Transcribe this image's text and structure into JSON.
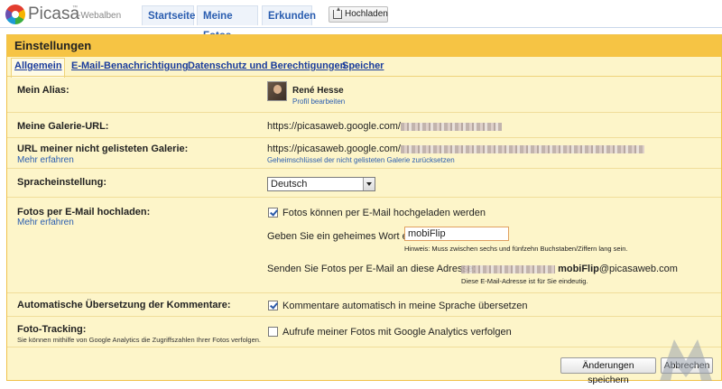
{
  "app": {
    "brand": "Picasa",
    "brand_tm": "™",
    "brand_sub": "-Webalben"
  },
  "nav": {
    "tabs": [
      "Startseite",
      "Meine Fotos",
      "Erkunden"
    ],
    "upload_label": "Hochladen"
  },
  "settings": {
    "title": "Einstellungen",
    "tabs": [
      "Allgemein",
      "E-Mail-Benachrichtigung",
      "Datenschutz und Berechtigungen",
      "Speicher"
    ],
    "active_tab": "Allgemein",
    "alias": {
      "label": "Mein Alias:",
      "name": "René Hesse",
      "edit_link": "Profil bearbeiten"
    },
    "gallery_url": {
      "label": "Meine Galerie-URL:",
      "value": "https://picasaweb.google.com/"
    },
    "unlisted_url": {
      "label": "URL meiner nicht gelisteten Galerie:",
      "learn_more": "Mehr erfahren",
      "value": "https://picasaweb.google.com/",
      "reset_link": "Geheimschlüssel der nicht gelisteten Galerie zurücksetzen"
    },
    "language": {
      "label": "Spracheinstellung:",
      "selected": "Deutsch"
    },
    "email_upload": {
      "label": "Fotos per E-Mail hochladen:",
      "learn_more": "Mehr erfahren",
      "checkbox_label": "Fotos können per E-Mail hochgeladen werden",
      "checked": true,
      "secret_label": "Geben Sie ein geheimes Wort ein:",
      "secret_value": "mobiFlip",
      "hint": "Hinweis: Muss zwischen sechs und fünfzehn Buchstaben/Ziffern lang sein.",
      "send_label": "Senden Sie Fotos per E-Mail an diese Adresse:",
      "address_visible": "mobiFlip@picasaweb.com",
      "address_note": "Diese E-Mail-Adresse ist für Sie eindeutig."
    },
    "auto_translate": {
      "label": "Automatische Übersetzung der Kommentare:",
      "checkbox_label": "Kommentare automatisch in meine Sprache übersetzen",
      "checked": true
    },
    "tracking": {
      "label": "Foto-Tracking:",
      "note": "Sie können mithilfe von Google Analytics die Zugriffszahlen Ihrer Fotos verfolgen.",
      "checkbox_label": "Aufrufe meiner Fotos mit Google Analytics verfolgen",
      "checked": false
    },
    "save_button": "Änderungen speichern",
    "cancel_button": "Abbrechen"
  },
  "colors": {
    "panel_bg": "#fdf5c9",
    "panel_header": "#f6c444",
    "link_blue": "#2a5db0"
  }
}
